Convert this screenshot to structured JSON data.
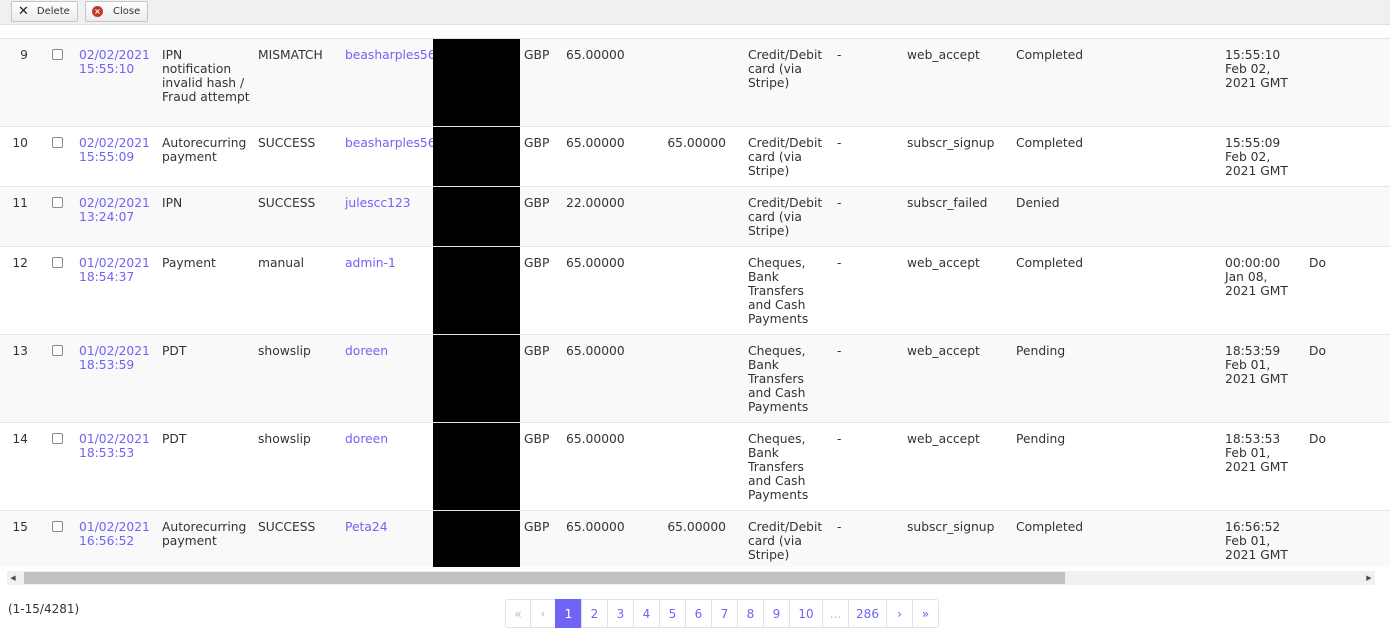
{
  "toolbar": {
    "delete_label": "Delete",
    "close_label": "Close"
  },
  "rows": [
    {
      "num": "9",
      "date": "02/02/2021 15:55:10",
      "type": "IPN notification invalid hash / Fraud attempt",
      "status": "MISMATCH",
      "user": "beasharples56",
      "currency": "GBP",
      "amount": "65.00000",
      "amount2": "",
      "method": "Credit/Debit card (via Stripe)",
      "dash": "-",
      "txn": "web_accept",
      "state": "Completed",
      "time": "15:55:10 Feb 02, 2021 GMT",
      "extra": ""
    },
    {
      "num": "10",
      "date": "02/02/2021 15:55:09",
      "type": "Autorecurring payment",
      "status": "SUCCESS",
      "user": "beasharples56",
      "currency": "GBP",
      "amount": "65.00000",
      "amount2": "65.00000",
      "method": "Credit/Debit card (via Stripe)",
      "dash": "-",
      "txn": "subscr_signup",
      "state": "Completed",
      "time": "15:55:09 Feb 02, 2021 GMT",
      "extra": ""
    },
    {
      "num": "11",
      "date": "02/02/2021 13:24:07",
      "type": "IPN",
      "status": "SUCCESS",
      "user": "julescc123",
      "currency": "GBP",
      "amount": "22.00000",
      "amount2": "",
      "method": "Credit/Debit card (via Stripe)",
      "dash": "-",
      "txn": "subscr_failed",
      "state": "Denied",
      "time": "",
      "extra": ""
    },
    {
      "num": "12",
      "date": "01/02/2021 18:54:37",
      "type": "Payment",
      "status": "manual",
      "user": "admin-1",
      "currency": "GBP",
      "amount": "65.00000",
      "amount2": "",
      "method": "Cheques, Bank Transfers and Cash Payments",
      "dash": "-",
      "txn": "web_accept",
      "state": "Completed",
      "time": "00:00:00 Jan 08, 2021 GMT",
      "extra": "Do"
    },
    {
      "num": "13",
      "date": "01/02/2021 18:53:59",
      "type": "PDT",
      "status": "showslip",
      "user": "doreen",
      "currency": "GBP",
      "amount": "65.00000",
      "amount2": "",
      "method": "Cheques, Bank Transfers and Cash Payments",
      "dash": "-",
      "txn": "web_accept",
      "state": "Pending",
      "time": "18:53:59 Feb 01, 2021 GMT",
      "extra": "Do"
    },
    {
      "num": "14",
      "date": "01/02/2021 18:53:53",
      "type": "PDT",
      "status": "showslip",
      "user": "doreen",
      "currency": "GBP",
      "amount": "65.00000",
      "amount2": "",
      "method": "Cheques, Bank Transfers and Cash Payments",
      "dash": "-",
      "txn": "web_accept",
      "state": "Pending",
      "time": "18:53:53 Feb 01, 2021 GMT",
      "extra": "Do"
    },
    {
      "num": "15",
      "date": "01/02/2021 16:56:52",
      "type": "Autorecurring payment",
      "status": "SUCCESS",
      "user": "Peta24",
      "currency": "GBP",
      "amount": "65.00000",
      "amount2": "65.00000",
      "method": "Credit/Debit card (via Stripe)",
      "dash": "-",
      "txn": "subscr_signup",
      "state": "Completed",
      "time": "16:56:52 Feb 01, 2021 GMT",
      "extra": ""
    }
  ],
  "footer": {
    "count_text": "(1-15/4281)"
  },
  "pagination": {
    "first": "«",
    "prev": "‹",
    "pages": [
      "1",
      "2",
      "3",
      "4",
      "5",
      "6",
      "7",
      "8",
      "9",
      "10",
      "...",
      "286"
    ],
    "next": "›",
    "last": "»",
    "active": "1"
  },
  "colors": {
    "accent": "#6f64f3",
    "redaction": "#000000"
  }
}
